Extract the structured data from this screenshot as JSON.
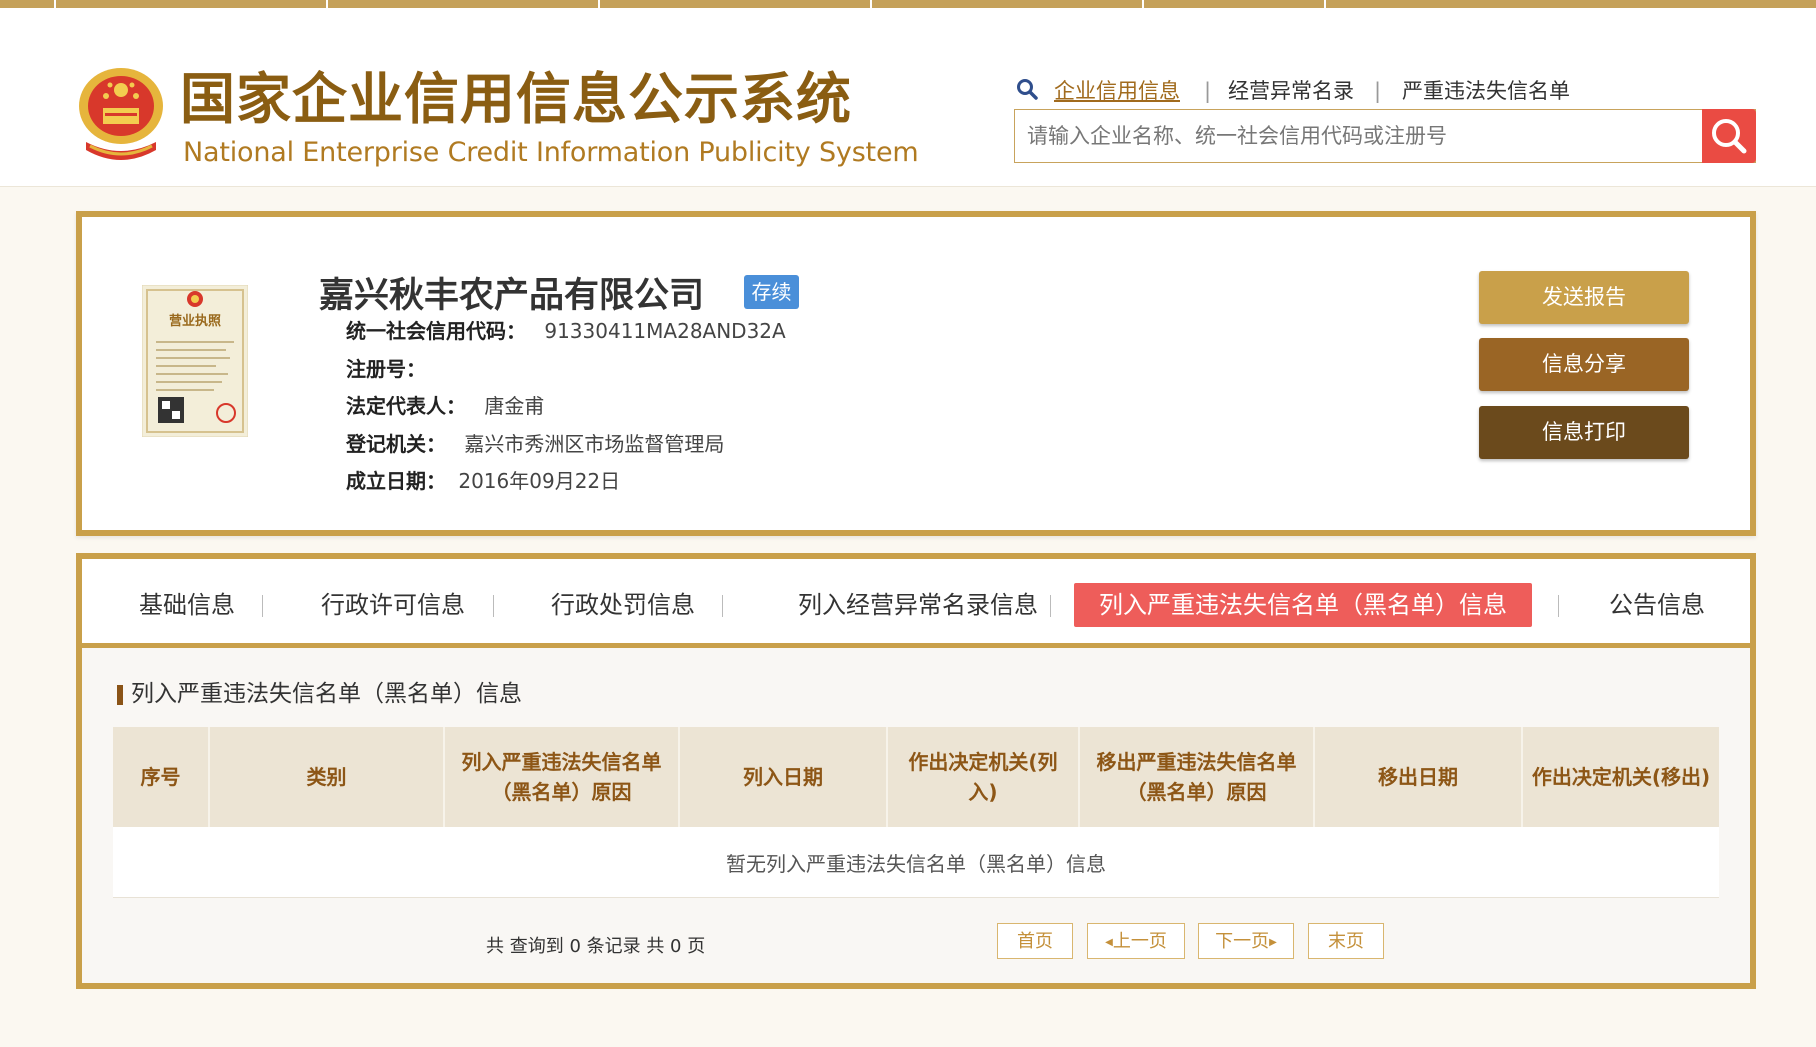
{
  "header": {
    "title_cn": "国家企业信用信息公示系统",
    "title_en": "National Enterprise Credit Information Publicity System",
    "nav": [
      {
        "label": "企业信用信息",
        "active": true
      },
      {
        "label": "经营异常名录",
        "active": false
      },
      {
        "label": "严重违法失信名单",
        "active": false
      }
    ],
    "nav_separator": "|",
    "search_placeholder": "请输入企业名称、统一社会信用代码或注册号"
  },
  "company": {
    "name": "嘉兴秋丰农产品有限公司",
    "status": "存续",
    "fields": [
      {
        "label": "统一社会信用代码：",
        "value": "91330411MA28AND32A"
      },
      {
        "label": "注册号：",
        "value": ""
      },
      {
        "label": "法定代表人：",
        "value": "唐金甫"
      },
      {
        "label": "登记机关：",
        "value": "嘉兴市秀洲区市场监督管理局"
      },
      {
        "label": "成立日期：",
        "value": "2016年09月22日"
      }
    ],
    "actions": [
      {
        "label": "发送报告",
        "color": "#c9a04a"
      },
      {
        "label": "信息分享",
        "color": "#9a6525"
      },
      {
        "label": "信息打印",
        "color": "#6b4a1c"
      }
    ],
    "license_text": "营业执照"
  },
  "tabs": [
    {
      "label": "基础信息",
      "active": false
    },
    {
      "label": "行政许可信息",
      "active": false
    },
    {
      "label": "行政处罚信息",
      "active": false
    },
    {
      "label": "列入经营异常名录信息",
      "active": false
    },
    {
      "label": "列入严重违法失信名单（黑名单）信息",
      "active": true
    },
    {
      "label": "公告信息",
      "active": false
    }
  ],
  "section": {
    "title": "列入严重违法失信名单（黑名单）信息",
    "columns": [
      "序号",
      "类别",
      "列入严重违法失信名单（黑名单）原因",
      "列入日期",
      "作出决定机关(列入)",
      "移出严重违法失信名单（黑名单）原因",
      "移出日期",
      "作出决定机关(移出)"
    ],
    "empty_text": "暂无列入严重违法失信名单（黑名单）信息",
    "summary": "共 查询到 0 条记录 共 0 页"
  },
  "pagination": {
    "first": "首页",
    "prev": "上一页",
    "next": "下一页",
    "last": "末页"
  },
  "colors": {
    "gold": "#c9a04a",
    "brown": "#8a5d12",
    "active_tab": "#ee5d5a",
    "status_badge": "#4a8fd9",
    "search_button": "#ea4b43"
  }
}
